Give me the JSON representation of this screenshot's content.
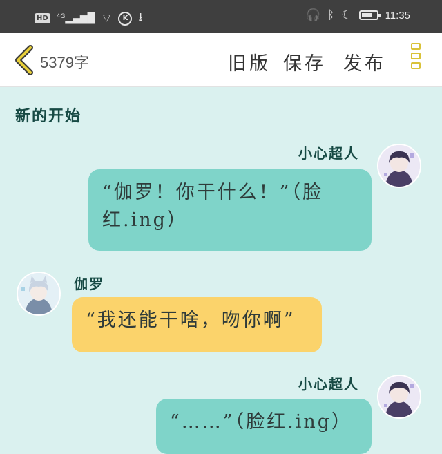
{
  "status_bar": {
    "hd": "HD",
    "network": "4G",
    "k_badge": "K",
    "time": "11:35",
    "battery_level": 0.7
  },
  "header": {
    "word_count": "5379字",
    "old_version": "旧版",
    "save": "保存",
    "publish": "发布"
  },
  "chapter_title": "新的开始",
  "messages": [
    {
      "sender": "小心超人",
      "side": "right",
      "color": "teal",
      "text": "“伽罗！你干什么！”（脸红.ing）"
    },
    {
      "sender": "伽罗",
      "side": "left",
      "color": "yellow",
      "text": "“我还能干啥，吻你啊”"
    },
    {
      "sender": "小心超人",
      "side": "right",
      "color": "teal",
      "text": "“……”（脸红.ing）"
    }
  ],
  "colors": {
    "background": "#daf1ef",
    "teal_bubble": "#7fd4c9",
    "yellow_bubble": "#fbd36b",
    "accent": "#d9c238"
  }
}
